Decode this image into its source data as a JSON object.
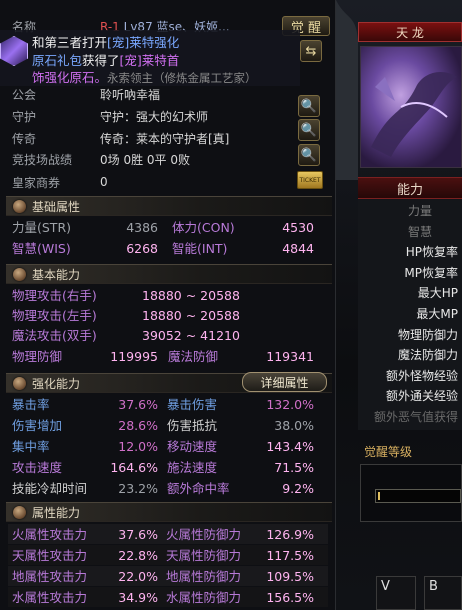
{
  "tooltip": {
    "line1_prefix": "和第三者打开",
    "line1_tag": "[宠]",
    "line1_suffix": "莱特强化",
    "line2_prefix": "原石礼包",
    "line2_mid": "获得了",
    "line2_tag": "[宠]",
    "line2_suffix": "莱特首",
    "line3": "饰强化原石。",
    "line3_tail": "永索领主（修炼金属工艺家）"
  },
  "info": {
    "name_label": "名称",
    "name_value": "R-1 Lv87 蓝se、妖姬...",
    "awaken_label": "觉 醒",
    "guild_label": "公会",
    "guild_value": "聆听吶幸福",
    "guard_label": "守护",
    "guard_value": "守护：强大的幻术师",
    "legend_label": "传奇",
    "legend_value": "传奇：莱本的守护者[真]",
    "arena_label": "竞技场战绩",
    "arena_value": "0场 0胜 0平 0败",
    "coupon_label": "皇家商券",
    "coupon_value": "0",
    "ticket_label": "TICKET"
  },
  "basic_attr": {
    "title": "基础属性",
    "str_label": "力量(STR)",
    "str_value": "4386",
    "con_label": "体力(CON)",
    "con_value": "4530",
    "wis_label": "智慧(WIS)",
    "wis_value": "6268",
    "int_label": "智能(INT)",
    "int_value": "4844"
  },
  "basic_ability": {
    "title": "基本能力",
    "rows": [
      {
        "label": "物理攻击(右手)",
        "value": "18880 ~ 20588"
      },
      {
        "label": "物理攻击(左手)",
        "value": "18880 ~ 20588"
      },
      {
        "label": "魔法攻击(双手)",
        "value": "39052 ~ 41210"
      }
    ],
    "pdef_label": "物理防御",
    "pdef_value": "119995",
    "mdef_label": "魔法防御",
    "mdef_value": "119341"
  },
  "enhance": {
    "title": "强化能力",
    "detail_button": "详细属性",
    "rows": [
      {
        "l1": "暴击率",
        "v1": "37.6%",
        "l2": "暴击伤害",
        "v2": "132.0%",
        "c1": "cl",
        "c2": "cl"
      },
      {
        "l1": "伤害增加",
        "v1": "28.6%",
        "l2": "伤害抵抗",
        "v2": "38.0%",
        "c1": "cl",
        "c2": "gl"
      },
      {
        "l1": "集中率",
        "v1": "12.0%",
        "l2": "移动速度",
        "v2": "143.4%",
        "c1": "cl",
        "c2": "pl"
      },
      {
        "l1": "攻击速度",
        "v1": "164.6%",
        "l2": "施法速度",
        "v2": "71.5%",
        "c1": "pl",
        "c2": "pl"
      },
      {
        "l1": "技能冷却时间",
        "v1": "23.2%",
        "l2": "额外命中率",
        "v2": "9.2%",
        "c1": "gl",
        "c2": "pl"
      }
    ]
  },
  "element": {
    "title": "属性能力",
    "rows": [
      {
        "l1": "火属性攻击力",
        "v1": "37.6%",
        "l2": "火属性防御力",
        "v2": "126.9%"
      },
      {
        "l1": "天属性攻击力",
        "v1": "22.8%",
        "l2": "天属性防御力",
        "v2": "117.5%"
      },
      {
        "l1": "地属性攻击力",
        "v1": "22.0%",
        "l2": "地属性防御力",
        "v2": "109.5%"
      },
      {
        "l1": "水属性攻击力",
        "v1": "34.9%",
        "l2": "水属性防御力",
        "v2": "156.5%"
      }
    ]
  },
  "right_panel": {
    "dragon_label": "天 龙",
    "ability_header": "能力",
    "items": [
      "力量",
      "智慧",
      "HP恢复率",
      "MP恢复率",
      "最大HP",
      "最大MP",
      "物理防御力",
      "魔法防御力",
      "额外怪物经验",
      "额外通关经验",
      "额外恶气值获得"
    ],
    "awaken_level": "觉醒等级",
    "slot_v": "V",
    "slot_b": "B"
  },
  "colors": {
    "purple_label": "#b87ad8",
    "pink_value": "#ffb4f0",
    "blue_label": "#6f9ee0",
    "red_name": "#e05050",
    "gold_button": "#e8d8a0"
  }
}
